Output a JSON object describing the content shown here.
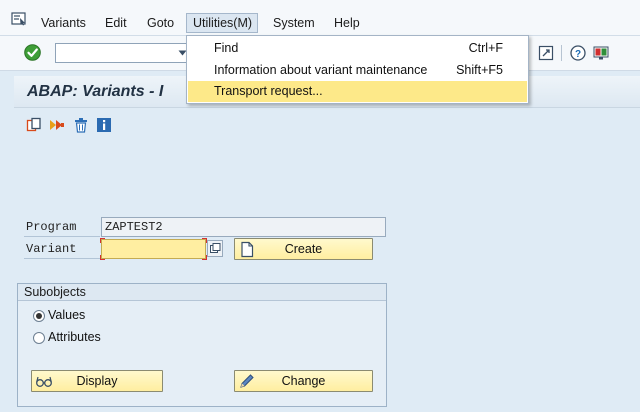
{
  "menubar": {
    "items": [
      "Variants",
      "Edit",
      "Goto",
      "Utilities(M)",
      "System",
      "Help"
    ]
  },
  "toolbar": {
    "command_value": ""
  },
  "title": "ABAP: Variants - I",
  "form": {
    "program_label": "Program",
    "program_value": "ZAPTEST2",
    "variant_label": "Variant",
    "variant_value": "",
    "create_label": "Create"
  },
  "subobjects": {
    "title": "Subobjects",
    "values_label": "Values",
    "attributes_label": "Attributes",
    "selected": "Values",
    "display_label": "Display",
    "change_label": "Change"
  },
  "utilities_menu": {
    "items": [
      {
        "label": "Find",
        "shortcut": "Ctrl+F"
      },
      {
        "label": "Information about variant maintenance",
        "shortcut": "Shift+F5"
      },
      {
        "label": "Transport request...",
        "shortcut": ""
      }
    ],
    "highlighted": "Transport request..."
  },
  "colors": {
    "accent_yellow": "#ffeea0",
    "menu_highlight": "#fde989",
    "background": "#dfebf5",
    "title_text": "#223244"
  },
  "icons": [
    "menu-icon",
    "ok-checkmark-icon",
    "save-icon",
    "help-icon",
    "customize-icon",
    "copy-icon",
    "rename-icon",
    "delete-icon",
    "info-icon",
    "possible-entries-icon",
    "create-doc-icon",
    "display-glasses-icon",
    "change-pencil-icon"
  ]
}
